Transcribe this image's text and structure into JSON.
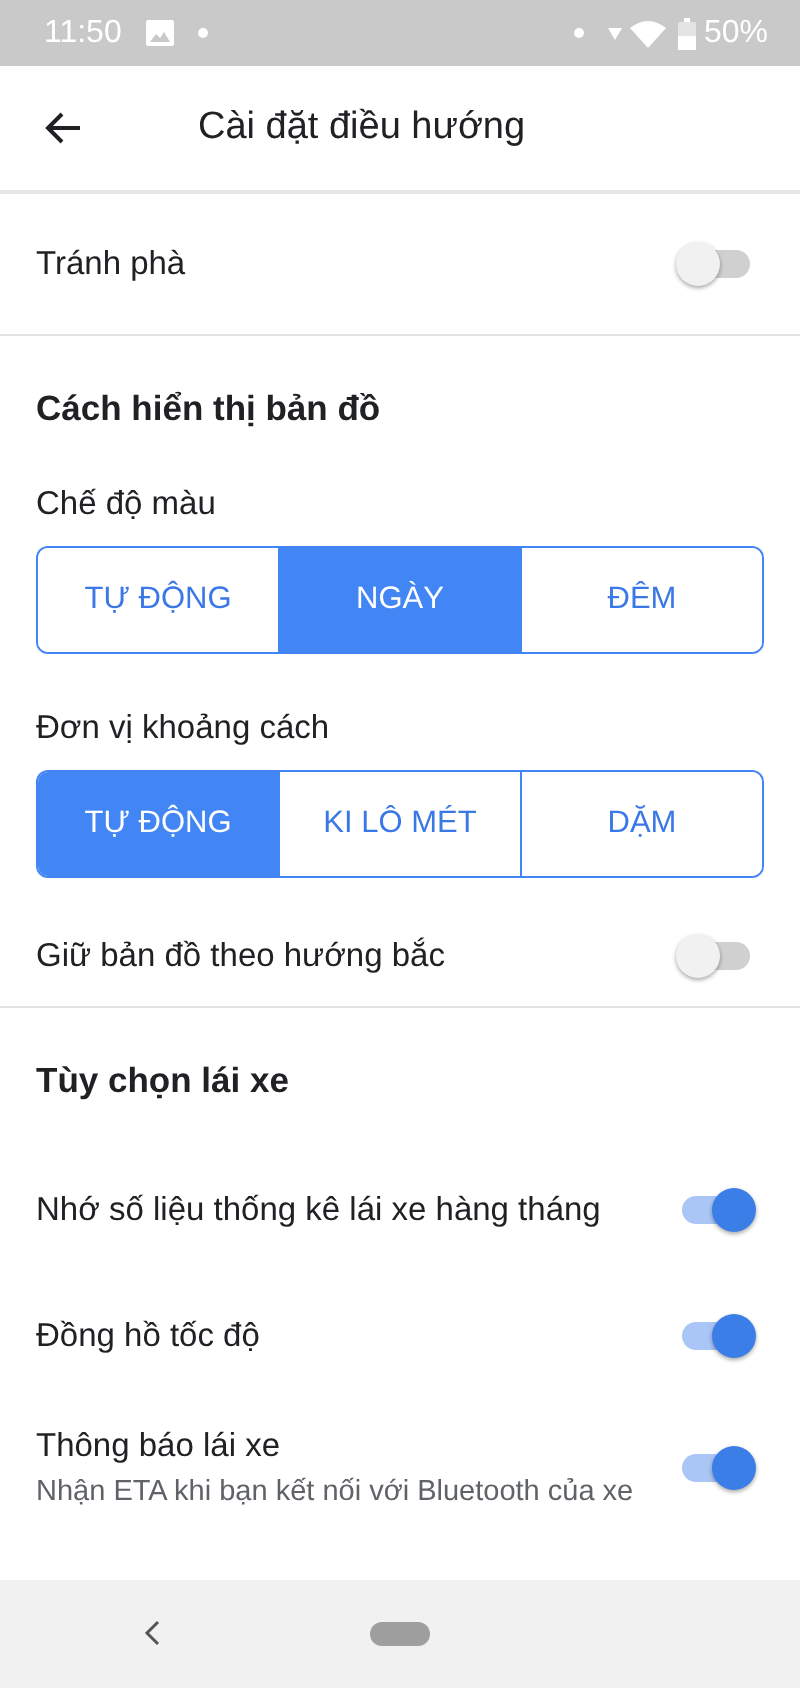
{
  "status_bar": {
    "time": "11:50",
    "battery": "50%"
  },
  "app_bar": {
    "title": "Cài đặt điều hướng"
  },
  "items": [
    {
      "kind": "toggle",
      "label": "Tránh phà",
      "on": false
    },
    {
      "kind": "divider"
    },
    {
      "kind": "header",
      "label": "Cách hiển thị bản đồ"
    },
    {
      "kind": "label",
      "label": "Chế độ màu"
    },
    {
      "kind": "segmented",
      "options": [
        {
          "label": "TỰ ĐỘNG",
          "selected": false
        },
        {
          "label": "NGÀY",
          "selected": true
        },
        {
          "label": "ĐÊM",
          "selected": false
        }
      ]
    },
    {
      "kind": "label",
      "label": "Đơn vị khoảng cách"
    },
    {
      "kind": "segmented",
      "options": [
        {
          "label": "TỰ ĐỘNG",
          "selected": true
        },
        {
          "label": "KI LÔ MÉT",
          "selected": false
        },
        {
          "label": "DẶM",
          "selected": false
        }
      ]
    },
    {
      "kind": "toggle",
      "label": "Giữ bản đồ theo hướng bắc",
      "on": false
    },
    {
      "kind": "divider"
    },
    {
      "kind": "header",
      "label": "Tùy chọn lái xe"
    },
    {
      "kind": "toggle",
      "label": "Nhớ số liệu thống kê lái xe hàng tháng",
      "on": true
    },
    {
      "kind": "toggle",
      "label": "Đồng hồ tốc độ",
      "on": true
    },
    {
      "kind": "toggle",
      "label": "Thông báo lái xe",
      "subtitle": "Nhận ETA khi bạn kết nối với Bluetooth của xe",
      "on": true
    }
  ]
}
